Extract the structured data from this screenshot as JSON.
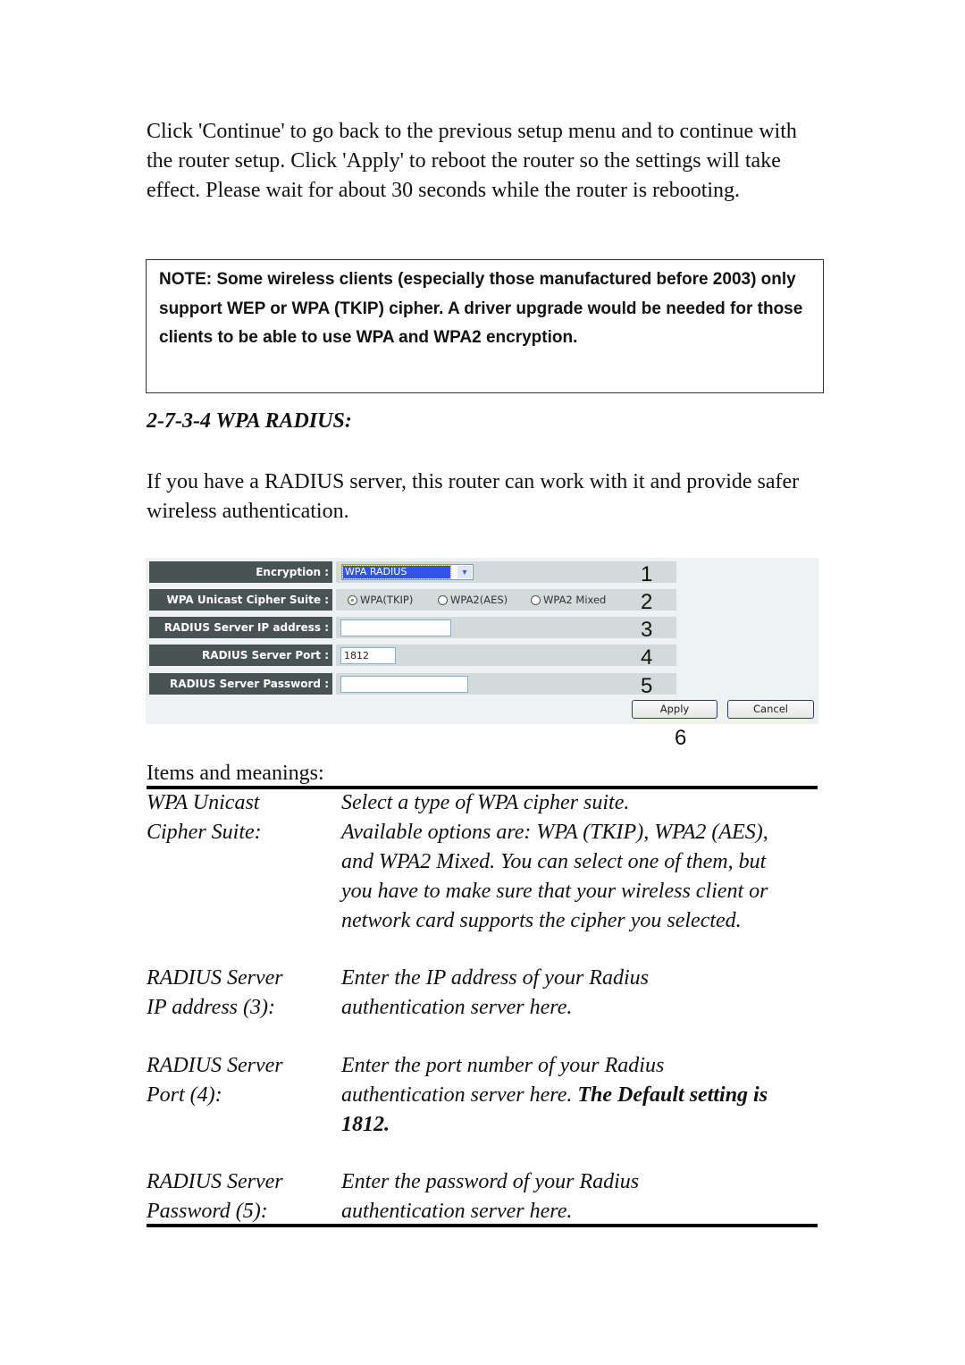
{
  "intro_paragraph": "Click 'Continue' to go back to the previous setup menu and to continue with the router setup. Click 'Apply' to reboot the router so the settings will take effect. Please wait for about 30 seconds while the router is rebooting.",
  "note": "NOTE: Some wireless clients (especially those manufactured before 2003) only support WEP or WPA (TKIP) cipher. A driver upgrade would be needed for those clients to be able to use WPA and WPA2 encryption.",
  "section_title": "2-7-3-4 WPA RADIUS:",
  "section_paragraph": "If you have a RADIUS server, this router can work with it and provide safer wireless authentication.",
  "router_form": {
    "encryption": {
      "label": "Encryption :",
      "value": "WPA RADIUS",
      "number": "1"
    },
    "cipher_suite": {
      "label": "WPA Unicast Cipher Suite :",
      "options": [
        "WPA(TKIP)",
        "WPA2(AES)",
        "WPA2 Mixed"
      ],
      "selected": "WPA(TKIP)",
      "number": "2"
    },
    "server_ip": {
      "label": "RADIUS Server IP address :",
      "value": "",
      "number": "3"
    },
    "server_port": {
      "label": "RADIUS Server Port :",
      "value": "1812",
      "number": "4"
    },
    "server_password": {
      "label": "RADIUS Server Password :",
      "value": "",
      "number": "5"
    },
    "apply_label": "Apply",
    "cancel_label": "Cancel",
    "buttons_number": "6"
  },
  "items_heading": "Items and meanings:",
  "items": [
    {
      "term": [
        "WPA Unicast",
        "Cipher Suite:"
      ],
      "definition": [
        "Select a type of WPA cipher suite.",
        "Available options are: WPA (TKIP), WPA2 (AES),",
        "and WPA2 Mixed. You can select one of them, but",
        "you have to make sure that your wireless client or",
        "network card supports the cipher you selected."
      ]
    },
    {
      "term": [
        "RADIUS Server",
        "IP address (3):"
      ],
      "definition": [
        "Enter the IP address of your Radius",
        "authentication server here."
      ]
    },
    {
      "term": [
        "RADIUS Server",
        "Port (4):"
      ],
      "definition": [
        "Enter the port number of your Radius",
        "authentication server here. "
      ],
      "definition_bold": [
        "The Default setting is",
        "1812."
      ]
    },
    {
      "term": [
        "RADIUS Server",
        "Password (5):"
      ],
      "definition": [
        "Enter the password of your Radius",
        "authentication server here."
      ]
    }
  ]
}
